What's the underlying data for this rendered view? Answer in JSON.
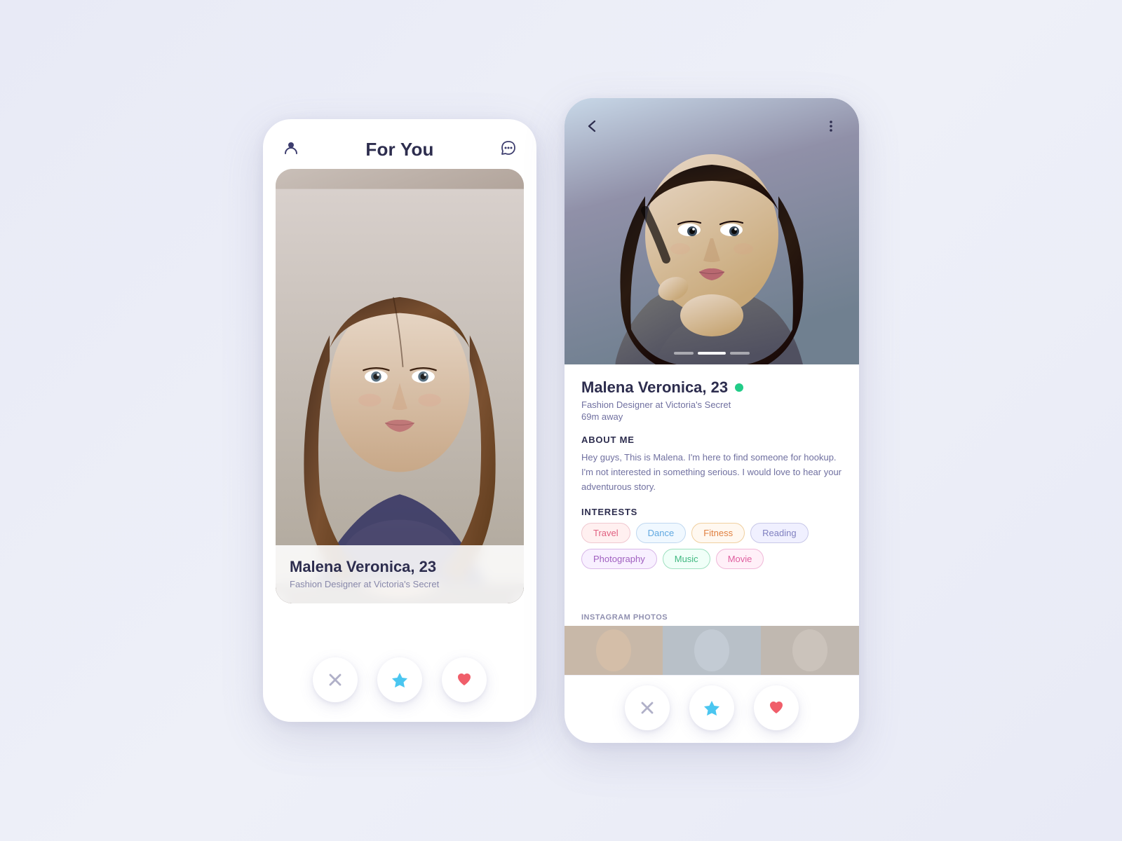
{
  "phone1": {
    "header": {
      "title": "For You",
      "person_icon": "👤",
      "bubble_icon": "💬"
    },
    "card": {
      "name": "Malena Veronica, 23",
      "job": "Fashion Designer at Victoria's Secret"
    },
    "actions": {
      "dislike_label": "✕",
      "boost_label": "★",
      "like_label": "♥"
    }
  },
  "phone2": {
    "profile": {
      "name": "Malena Veronica, 23",
      "job": "Fashion Designer at Victoria's Secret",
      "distance": "69m away",
      "online": true,
      "about_title": "ABOUT ME",
      "about_text": "Hey guys, This is Malena. I'm here to find someone for hookup. I'm not interested in something serious. I would love to hear your adventurous story.",
      "interests_title": "INTERESTS",
      "interests": [
        {
          "label": "Travel",
          "class": "tag-travel"
        },
        {
          "label": "Dance",
          "class": "tag-dance"
        },
        {
          "label": "Fitness",
          "class": "tag-fitness"
        },
        {
          "label": "Reading",
          "class": "tag-reading"
        },
        {
          "label": "Photography",
          "class": "tag-photography"
        },
        {
          "label": "Music",
          "class": "tag-music"
        },
        {
          "label": "Movie",
          "class": "tag-movie"
        }
      ],
      "instagram_label": "INSTAGRAM PHOTOS"
    },
    "actions": {
      "dislike_label": "✕",
      "boost_label": "★",
      "like_label": "♥"
    }
  },
  "colors": {
    "accent_blue": "#4ac6f0",
    "accent_red": "#f05e6a",
    "accent_gray": "#b0b0c8",
    "bg": "#e8eaf6"
  }
}
